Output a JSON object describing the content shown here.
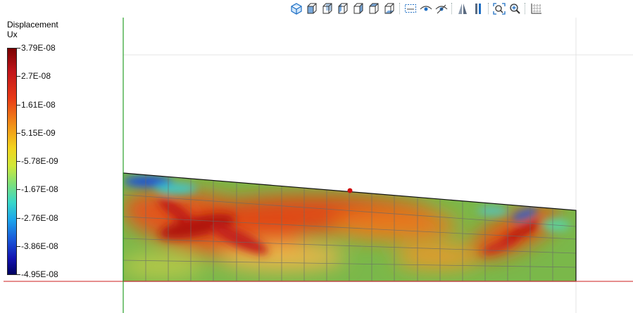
{
  "toolbar": {
    "tools": [
      {
        "name": "view-iso-icon"
      },
      {
        "name": "view-front-icon"
      },
      {
        "name": "view-back-icon"
      },
      {
        "name": "view-left-icon"
      },
      {
        "name": "view-right-icon"
      },
      {
        "name": "view-top-icon"
      },
      {
        "name": "view-bottom-icon"
      },
      {
        "sep": true
      },
      {
        "name": "select-region-icon"
      },
      {
        "name": "show-eye-icon"
      },
      {
        "name": "hide-eye-icon"
      },
      {
        "sep": true
      },
      {
        "name": "mirror-view-icon"
      },
      {
        "name": "column-view-icon"
      },
      {
        "sep": true
      },
      {
        "name": "zoom-fit-icon"
      },
      {
        "name": "zoom-in-icon"
      },
      {
        "sep": true
      },
      {
        "name": "grid-settings-icon"
      }
    ]
  },
  "legend": {
    "title_line1": "Displacement",
    "title_line2": "Ux",
    "ticks": [
      "3.79E-08",
      "2.7E-08",
      "1.61E-08",
      "5.15E-09",
      "-5.78E-09",
      "-1.67E-08",
      "-2.76E-08",
      "-3.86E-08",
      "-4.95E-08"
    ]
  },
  "colors": {
    "x_axis": "#d84a4a",
    "y_axis": "#2aa02a",
    "probe_point": "#d01010",
    "toolbar_icon": "#1f6fc4"
  }
}
